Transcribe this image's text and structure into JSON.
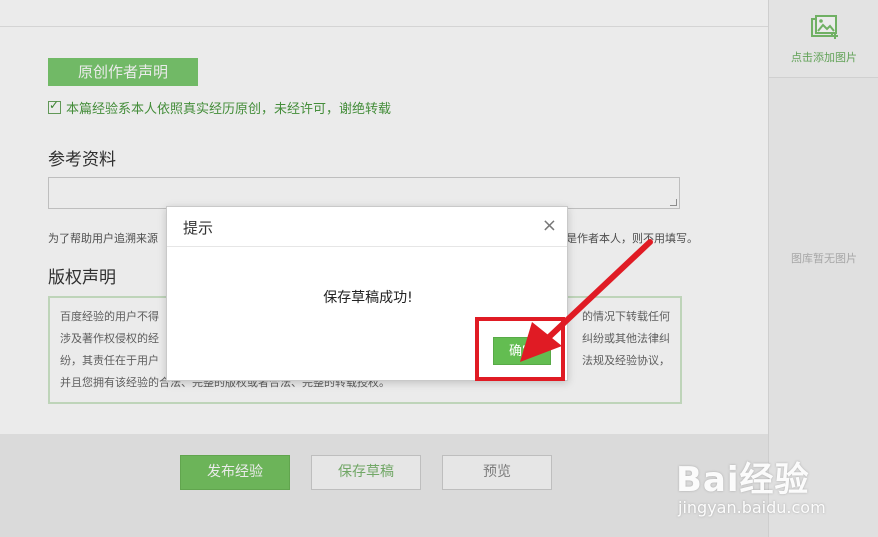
{
  "editor": {
    "original_section_label": "原创作者声明",
    "original_checkbox_text": "本篇经验系本人依照真实经历原创，未经许可，谢绝转载",
    "reference_title": "参考资料",
    "reference_help_left": "为了帮助用户追溯来源",
    "reference_help_right": "是作者本人，则不用填写。",
    "copyright_title": "版权声明",
    "copyright_lines": [
      "百度经验的用户不得",
      "涉及著作权侵权的经",
      "纷，其责任在于用户",
      "并且您拥有该经验的合法、完整的版权或者合法、完整的转载授权。"
    ],
    "copyright_lines_right": [
      "的情况下转载任何",
      "纠纷或其他法律纠",
      "法规及经验协议，"
    ]
  },
  "footer": {
    "publish_label": "发布经验",
    "save_draft_label": "保存草稿",
    "preview_label": "预览"
  },
  "sidebar": {
    "add_image_label": "点击添加图片",
    "empty_label": "图库暂无图片"
  },
  "dialog": {
    "title": "提示",
    "close_label": "×",
    "message": "保存草稿成功!",
    "ok_label": "确定"
  },
  "watermark": {
    "logo_text": "Bai经验",
    "url_text": "jingyan.baidu.com"
  },
  "colors": {
    "brand_green": "#76c461",
    "annotation_red": "#e01b24"
  }
}
